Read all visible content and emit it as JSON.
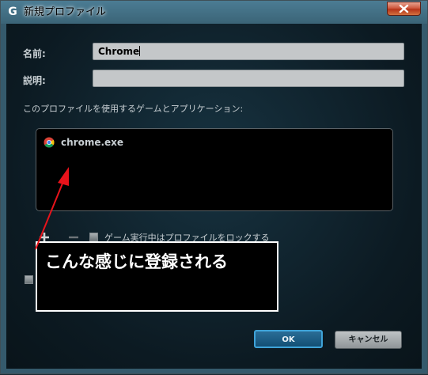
{
  "window": {
    "title": "新規プロファイル",
    "app_icon": "logitech-g-icon",
    "close_icon": "close-icon"
  },
  "form": {
    "name_label": "名前:",
    "name_value": "Chrome",
    "description_label": "説明:",
    "description_value": "",
    "apps_heading": "このプロファイルを使用するゲームとアプリケーション:"
  },
  "apps_list": [
    {
      "label": "chrome.exe",
      "icon": "chrome-icon"
    }
  ],
  "options": {
    "lock_profile_label": "ゲーム実行中はプロファイルをロックする",
    "lock_profile_checked": false
  },
  "buttons": {
    "ok": "OK",
    "cancel": "キャンセル"
  },
  "annotation": {
    "text": "こんな感じに登録される",
    "arrow_color": "#e8131b"
  },
  "colors": {
    "ok_border": "#3fa3d8",
    "titlebar": "#3b6477"
  }
}
